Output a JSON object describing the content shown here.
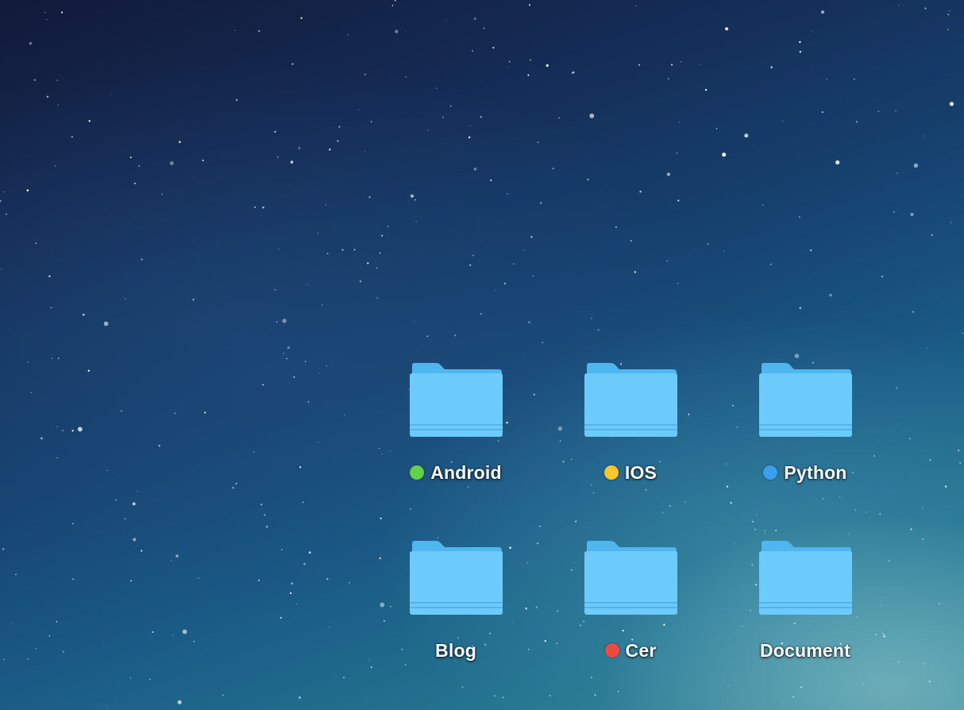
{
  "desktop": {
    "folders": [
      {
        "name": "Android",
        "tag_color": "#62d249"
      },
      {
        "name": "IOS",
        "tag_color": "#f9c62b"
      },
      {
        "name": "Python",
        "tag_color": "#3aa0ee"
      },
      {
        "name": "Blog",
        "tag_color": ""
      },
      {
        "name": "Cer",
        "tag_color": "#f04944"
      },
      {
        "name": "Document",
        "tag_color": ""
      }
    ],
    "folder_icon": "folder-icon",
    "folder_colors": {
      "back": "#4fb6ef",
      "front": "#6ccbfb"
    }
  }
}
